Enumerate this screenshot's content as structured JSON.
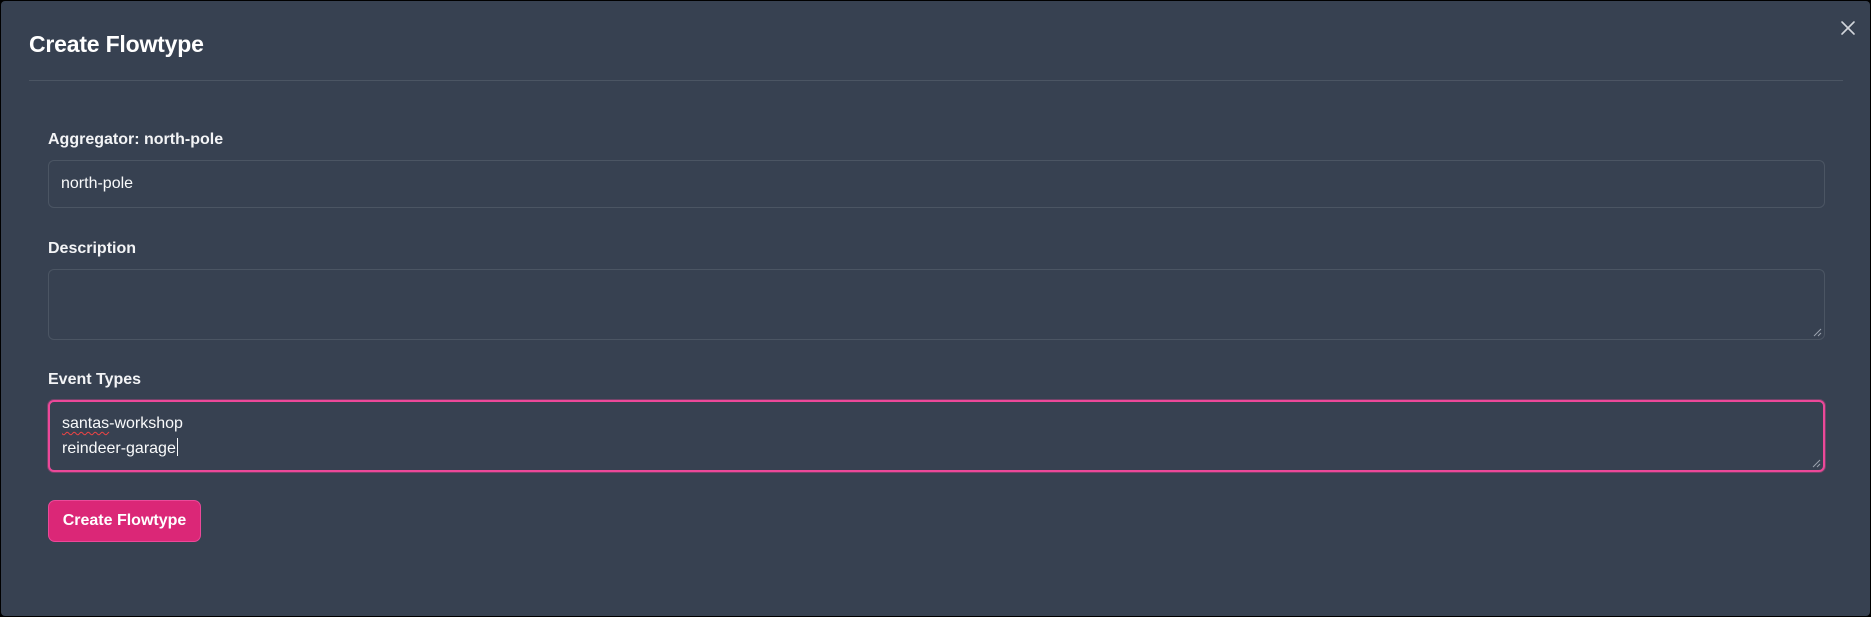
{
  "modal": {
    "title": "Create Flowtype",
    "close_icon": "close-icon"
  },
  "form": {
    "aggregator": {
      "label": "Aggregator: north-pole",
      "value": "north-pole"
    },
    "description": {
      "label": "Description",
      "value": ""
    },
    "event_types": {
      "label": "Event Types",
      "lines": [
        "santas-workshop",
        "reindeer-garage"
      ],
      "misspelled_word": "santas",
      "focused": true
    },
    "submit_label": "Create Flowtype"
  },
  "colors": {
    "modal_bg": "#374151",
    "accent": "#db2777",
    "focus_border": "#ec4899",
    "border": "#4b5563",
    "text": "#f9fafb"
  }
}
